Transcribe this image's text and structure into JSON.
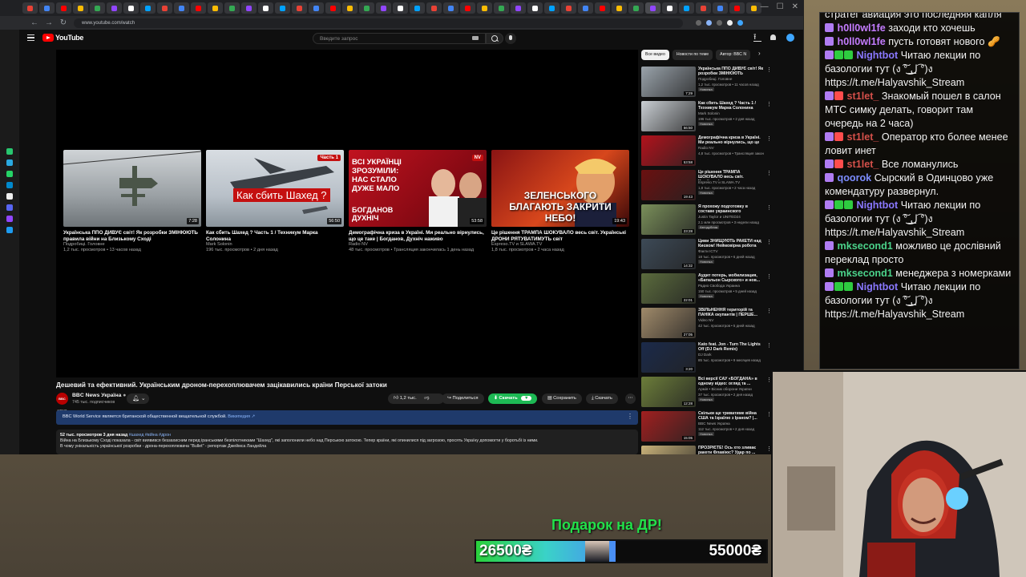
{
  "browser": {
    "url": "www.youtube.com/watch",
    "tab_count": 44
  },
  "youtube": {
    "logo_text": "YouTube",
    "search_placeholder": "Введите запрос",
    "end_screen": [
      {
        "title": "Українська ППО ДИВУЄ світ! Як розробки ЗМІНЮЮТЬ правила війни на Близькому Сході",
        "channel": "Подробиці. Головне",
        "meta": "1,2 тыс. просмотров • 13 часов назад",
        "duration": "7:28"
      },
      {
        "title": "Как сбить Шахед ? Часть 1 / Техникум Марка Солонина",
        "channel": "Mark Solonin",
        "meta": "196 тыс. просмотров • 2 дня назад",
        "duration": "56:50",
        "overlay": "Как сбить Шахед ?",
        "corner": "Часть 1"
      },
      {
        "title": "Демографічна криза в Україні. Ми реально вірнулись, що це таке | Богданов, Духнiч наживо",
        "channel": "Radio NV",
        "meta": "48 тыс. просмотров • Трансляция закончилась 1 день назад",
        "duration": "53:58",
        "overlay": "ВСІ УКРАЇНЦІ ЗРОЗУМІЛИ: НАС СТАЛО ДУЖЕ МАЛО",
        "overlay2": "БОГДАНОВ ДУХНІЧ",
        "corner": "NV"
      },
      {
        "title": "Це рішення ТРАМПА ШОКУВАЛО весь світ. Українські ДРОНИ РЯТУВАТИМУТЬ світ",
        "channel": "Espreso.TV и SLAWA.TV",
        "meta": "1,8 тыс. просмотров • 2 часа назад",
        "duration": "19:43",
        "overlay": "ЗЕЛЕНСЬКОГО БЛАГАЮТЬ ЗАКРИТИ НЕБО!"
      }
    ],
    "video": {
      "title": "Дешевий та ефективний. Українським дроном-перехоплювачем зацікавились країни Перської затоки",
      "channel": "BBC News Україна",
      "channel_avatar": "BBC NEWS",
      "subscribers": "745 тыс. подписчиков",
      "likes": "1,2 тыс.",
      "share": "Поделиться",
      "download": "Скачать",
      "save": "Сохранить",
      "clip": "Скачать",
      "info_banner": "BBC World Service является британской общественной вещательной службой.",
      "info_link": "Википедия ↗",
      "desc_stats": "52 тыс. просмотров  3 дня назад",
      "desc_tags": "#шахед #війна #дрон",
      "desc_line1": "Війна на Близькому Сході показала - світ виявився беззахисним перед іранськими безпілотниками \"Шахед\", які заполонили небо над Перською затокою. Тепер країни, які опинилися під загрозою, просять Україну допомогти у боротьбі із ними.",
      "desc_line2": "В чому унікальність української розробки - дрона-перехоплювача \"Bullet\" - репортаж Джеймса Ландейла"
    },
    "chips": [
      "Все видео",
      "Новости по теме",
      "Автор: BBC N"
    ],
    "recommendations": [
      {
        "title": "Українська ППО ДИВУЄ світ! Як розробки ЗМІНЮЮТЬ",
        "channel": "Подробиці. Головне",
        "meta": "1,2 тыс. просмотров • 11 часов назад",
        "duration": "7:29",
        "badge": "Новинка"
      },
      {
        "title": "Как сбить Шахед ? Часть 1 / Техникум Марка Солонина",
        "channel": "Mark Solonin",
        "meta": "196 тыс. просмотров • 2 дня назад",
        "duration": "56:50",
        "badge": "Новинка"
      },
      {
        "title": "Демографічна криза в Україні. Ми реально вірнулись, що це",
        "channel": "Radio NV",
        "meta": "4,8 тыс. просмотров • Трансляция закон",
        "duration": "53:58",
        "badge": ""
      },
      {
        "title": "Це рішення ТРАМПА ШОКУВАЛО весь світ. Українські",
        "channel": "Espreso.TV и SLAWA.TV",
        "meta": "1,8 тыс. просмотров • 2 часа назад",
        "duration": "19:43",
        "badge": "Новинка"
      },
      {
        "title": "Я прохожу подготовку в составе украинского",
        "channel": "Justin Taylor и UNITED24",
        "meta": "2,1 млн просмотров • 3 недели назад",
        "duration": "23:28",
        "badge": "Автодубляж"
      },
      {
        "title": "Циви ЗНИЩУЮТЬ РАКЕТИ над Києвом! Неймовірна робота",
        "channel": "Факти ICTV",
        "meta": "18 тыс. просмотров • 6 дней назад",
        "duration": "14:32",
        "badge": "Новинка"
      },
      {
        "title": "Аудит потерь, мобилизация, «Батальон Сырского» и нов...",
        "channel": "Радио Свобода Украина",
        "meta": "150 тыс. просмотров • 5 дней назад",
        "duration": "22:01",
        "badge": "Новинка"
      },
      {
        "title": "ЗВІЛЬНЕННЯ територій та ПАНІКА окупантів | ПЕРШЕ...",
        "channel": "Video NV",
        "meta": "42 тыс. просмотров • 5 дней назад",
        "duration": "27:05",
        "badge": ""
      },
      {
        "title": "Kato feat. Jon - Turn The Lights Off (DJ Dark Remix)",
        "channel": "DJ Dark",
        "meta": "85 тыс. просмотров • 9 месяцев назад",
        "duration": "3:20",
        "badge": ""
      },
      {
        "title": "Всі версії САУ «БОГДАНА» в одному відео: огляд та ...",
        "channel": "Армія • Вісник оборони України",
        "meta": "37 тыс. просмотров • 2 дня назад",
        "duration": "12:28",
        "badge": "Новинка"
      },
      {
        "title": "Скільки ще триватиме війна США та Ізраїлю з Іраном? |...",
        "channel": "BBC News Україна",
        "meta": "112 тыс. просмотров • 2 дня назад",
        "duration": "15:05",
        "badge": "Новинка"
      },
      {
        "title": "ПРОЗРІЄТЕ! Ось хто зливає ракети Флавіюс? Удар по ...",
        "channel": "",
        "meta": "",
        "duration": "",
        "badge": ""
      }
    ]
  },
  "chat": {
    "messages": [
      {
        "user": "",
        "color": "#ffffff",
        "text": "стратег авиация это последняя капля",
        "badges": [],
        "partial": true
      },
      {
        "user": "h0ll0wl1fe",
        "color": "#c47cff",
        "text": "заходи кто хочешь",
        "badges": [
          "#b07cf2"
        ]
      },
      {
        "user": "h0ll0wl1fe",
        "color": "#c47cff",
        "text": "пусть готовят нового 🥜",
        "badges": [
          "#b07cf2"
        ]
      },
      {
        "user": "Nightbot",
        "color": "#8a78ff",
        "text": "Читаю лекции по базологии тут (ง ͠° ͟ل͜ ͡°)ง https://t.me/Halyavshik_Stream",
        "badges": [
          "#b07cf2",
          "#2ecc40",
          "#2ecc40"
        ]
      },
      {
        "user": "st1let_",
        "color": "#d4504a",
        "text": "Знакомый пошел в салон МТС симку делать, говорит там очередь на 2 часа)",
        "badges": [
          "#b07cf2",
          "#ff4d4d"
        ]
      },
      {
        "user": "st1let_",
        "color": "#d4504a",
        "text": "Оператор кто более менее ловит инет",
        "badges": [
          "#b07cf2",
          "#ff4d4d"
        ]
      },
      {
        "user": "st1let_",
        "color": "#d4504a",
        "text": "Все ломанулись",
        "badges": [
          "#b07cf2",
          "#ff4d4d"
        ]
      },
      {
        "user": "qoorok",
        "color": "#7c8cff",
        "text": "Сырский в Одинцово уже комендатуру развернул.",
        "badges": [
          "#b07cf2"
        ]
      },
      {
        "user": "Nightbot",
        "color": "#8a78ff",
        "text": "Читаю лекции по базологии тут (ง ͠° ͟ل͜ ͡°)ง https://t.me/Halyavshik_Stream",
        "badges": [
          "#b07cf2",
          "#2ecc40",
          "#2ecc40"
        ]
      },
      {
        "user": "mksecond1",
        "color": "#4bd28a",
        "text": "можливо це дослівний переклад просто",
        "badges": [
          "#b07cf2"
        ]
      },
      {
        "user": "mksecond1",
        "color": "#4bd28a",
        "text": "менеджера з номерками",
        "badges": [
          "#b07cf2"
        ]
      },
      {
        "user": "Nightbot",
        "color": "#8a78ff",
        "text": "Читаю лекции по базологии тут (ง ͠° ͟ل͜ ͡°)ง https://t.me/Halyavshik_Stream",
        "badges": [
          "#b07cf2",
          "#2ecc40",
          "#2ecc40"
        ]
      }
    ]
  },
  "donation": {
    "title": "Подарок на ДР!",
    "current": "26500₴",
    "goal": "55000₴",
    "progress": 0.48,
    "colors": {
      "start": "#2ad13a",
      "end": "#4a8cf5"
    }
  }
}
